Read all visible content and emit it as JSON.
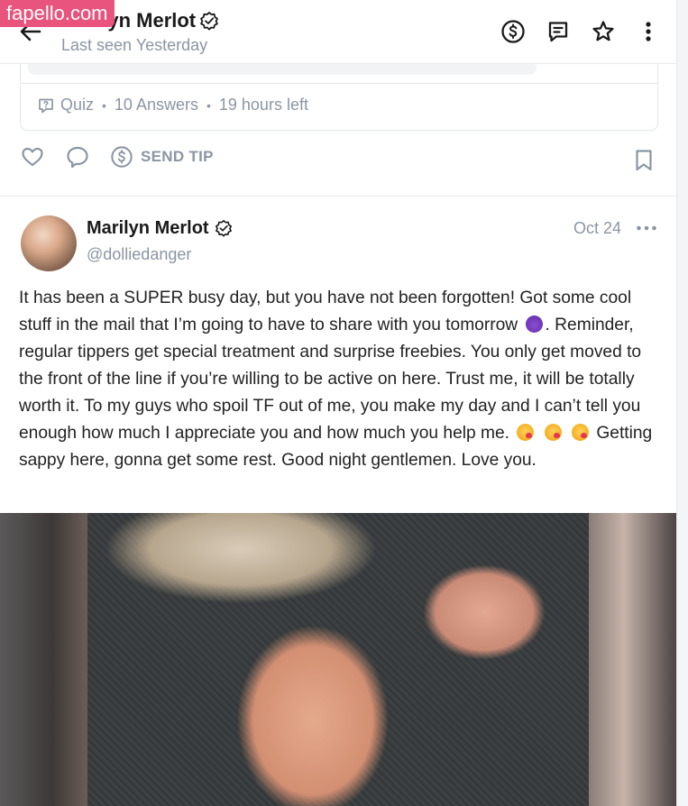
{
  "watermark": "fapello.com",
  "header": {
    "title": "Marilyn Merlot",
    "subtitle": "Last seen Yesterday",
    "icons": [
      "back-arrow-icon",
      "dollar-icon",
      "message-icon",
      "star-icon",
      "more-vertical-icon"
    ]
  },
  "previous_post": {
    "quiz_label": "Quiz",
    "answers": "10 Answers",
    "time_left": "19 hours left",
    "send_tip": "SEND TIP",
    "icons": [
      "quiz-icon",
      "heart-icon",
      "comment-icon",
      "dollar-icon",
      "bookmark-icon"
    ]
  },
  "post": {
    "author_name": "Marilyn Merlot",
    "handle": "@dolliedanger",
    "date": "Oct 24",
    "text_parts": [
      "It has been a SUPER busy day, but you have not been forgotten! Got some cool stuff in the mail that I’m going to have to share with you tomorrow",
      ". Reminder, regular tippers get special treatment and surprise freebies. You only get moved to the front of the line if you’re willing to be active on here. Trust me, it will be totally worth it. To my guys who spoil TF out of me, you make my day and I can’t tell you enough how much I appreciate you and how much you help me.",
      " Getting sappy here, gonna get some rest. Good night gentlemen. Love you."
    ],
    "emojis": [
      "smiling-devil-emoji",
      "face-blowing-kiss-emoji"
    ]
  },
  "colors": {
    "muted": "#8a96a3",
    "text": "#222222",
    "watermark": "#e8547d",
    "border": "#e6e8eb"
  }
}
